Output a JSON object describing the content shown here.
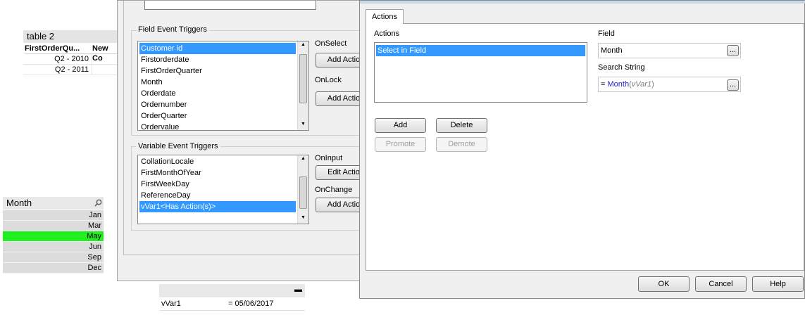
{
  "table2": {
    "title": "table 2",
    "columns": [
      "FirstOrderQu...",
      "New Co"
    ],
    "rows": [
      [
        "Q2 - 2010",
        ""
      ],
      [
        "Q2 - 2011",
        ""
      ]
    ]
  },
  "month_listbox": {
    "title": "Month",
    "items": [
      "Jan",
      "Mar",
      "May",
      "Jun",
      "Sep",
      "Dec"
    ],
    "selected": "May"
  },
  "variable_box": {
    "minimize_glyph": "▬",
    "name": "vVar1",
    "value": "= 05/06/2017"
  },
  "triggers_dialog": {
    "field_group_label": "Field Event Triggers",
    "field_items": [
      "Customer id",
      "Firstorderdate",
      "FirstOrderQuarter",
      "Month",
      "Orderdate",
      "Ordernumber",
      "OrderQuarter",
      "Ordervalue"
    ],
    "field_selected": "Customer id",
    "on_select_label": "OnSelect",
    "on_select_button": "Add Actio",
    "on_lock_label": "OnLock",
    "on_lock_button": "Add Actio",
    "variable_group_label": "Variable Event Triggers",
    "variable_items": [
      "CollationLocale",
      "FirstMonthOfYear",
      "FirstWeekDay",
      "ReferenceDay",
      "vVar1<Has Action(s)>"
    ],
    "variable_selected": "vVar1<Has Action(s)>",
    "on_input_label": "OnInput",
    "on_input_button": "Edit Actio",
    "on_change_label": "OnChange",
    "on_change_button": "Add Actio"
  },
  "actions_dialog": {
    "tab_label": "Actions",
    "actions_label": "Actions",
    "actions_items": [
      "Select in Field"
    ],
    "field_label": "Field",
    "field_value": "Month",
    "search_label": "Search String",
    "search_prefix": "= ",
    "search_func": "Month",
    "search_open": "(",
    "search_var": "vVar1",
    "search_close": ")",
    "browse_button": "...",
    "add_button": "Add",
    "delete_button": "Delete",
    "promote_button": "Promote",
    "demote_button": "Demote",
    "ok_button": "OK",
    "cancel_button": "Cancel",
    "help_button": "Help"
  },
  "icons": {
    "search": "search-icon",
    "scroll_up": "▲",
    "scroll_down": "▼"
  },
  "colors": {
    "selection_blue": "#3399ff",
    "selected_green": "#22ee22",
    "keyword_blue": "#2222cc"
  }
}
